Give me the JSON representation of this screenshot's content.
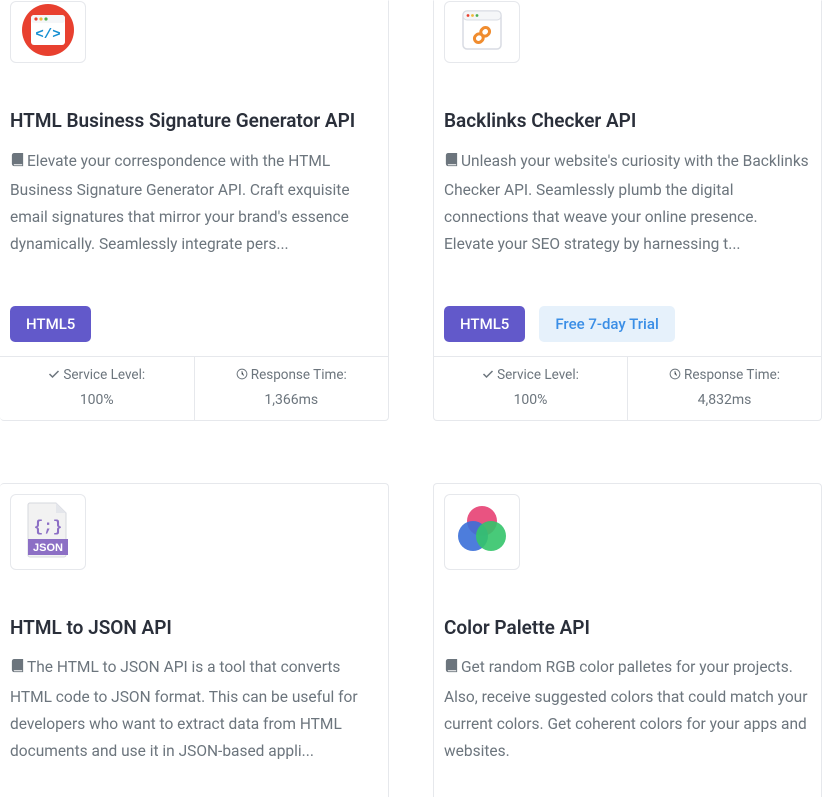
{
  "labels": {
    "service_level": "Service Level:",
    "response_time": "Response Time:"
  },
  "cards": [
    {
      "title": "HTML Business Signature Generator API",
      "desc": "Elevate your correspondence with the HTML Business Signature Generator API. Craft exquisite email signatures that mirror your brand's essence dynamically. Seamlessly integrate pers...",
      "tags": [
        {
          "text": "HTML5",
          "style": "purple"
        }
      ],
      "service_level": "100%",
      "response_time": "1,366ms"
    },
    {
      "title": "Backlinks Checker API",
      "desc": "Unleash your website's curiosity with the Backlinks Checker API. Seamlessly plumb the digital connections that weave your online presence. Elevate your SEO strategy by harnessing t...",
      "tags": [
        {
          "text": "HTML5",
          "style": "purple"
        },
        {
          "text": "Free 7-day Trial",
          "style": "blue-light"
        }
      ],
      "service_level": "100%",
      "response_time": "4,832ms"
    },
    {
      "title": "HTML to JSON API",
      "desc": "The HTML to JSON API is a tool that converts HTML code to JSON format. This can be useful for developers who want to extract data from HTML documents and use it in JSON-based appli...",
      "tags": [],
      "service_level": "",
      "response_time": ""
    },
    {
      "title": "Color Palette API",
      "desc": "Get random RGB color palletes for your projects. Also, receive suggested colors that could match your current colors. Get coherent colors for your apps and websites.",
      "tags": [],
      "service_level": "",
      "response_time": ""
    }
  ]
}
